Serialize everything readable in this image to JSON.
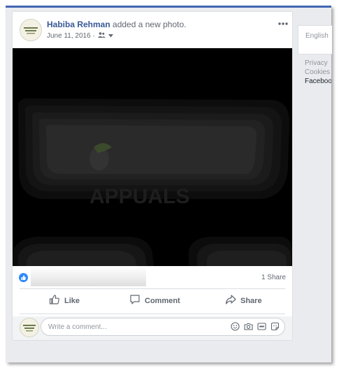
{
  "post": {
    "author": "Habiba Rehman",
    "action": "added a new photo.",
    "date": "June 11, 2016 ·",
    "photo_watermark": "APPUALS",
    "share_count": "1 Share",
    "actions": {
      "like": "Like",
      "comment": "Comment",
      "share": "Share"
    },
    "comment_placeholder": "Write a comment..."
  },
  "sidebar": {
    "language": "English",
    "links": [
      "Privacy",
      "Cookies",
      "Facebook"
    ]
  },
  "colors": {
    "brand_blue": "#4267b2",
    "author_link": "#385898",
    "like_badge": "#2d88ff",
    "page_bg": "#e9ebee"
  },
  "icons": [
    "more-icon",
    "friends-audience-icon",
    "dropdown-caret-icon",
    "like-reaction-icon",
    "thumbs-up-icon",
    "comment-icon",
    "share-arrow-icon",
    "emoji-icon",
    "camera-icon",
    "gif-icon",
    "sticker-icon"
  ]
}
